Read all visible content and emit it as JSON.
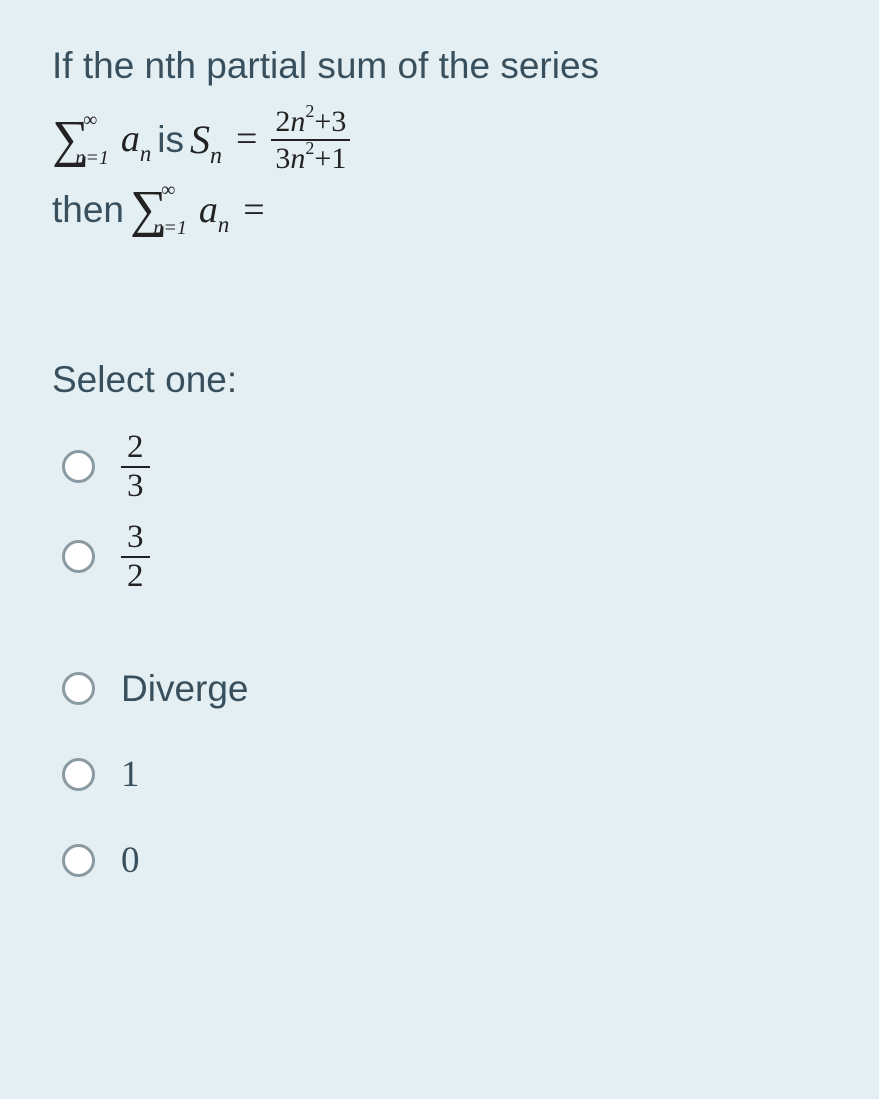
{
  "question": {
    "intro": "If the nth partial sum of the series",
    "sigma_upper": "∞",
    "sigma_lower": "n=1",
    "term": "a",
    "term_sub": "n",
    "is_word": "is",
    "Sn_S": "S",
    "Sn_sub": "n",
    "equals": "=",
    "frac_num_coeff": "2",
    "frac_num_var": "n",
    "frac_num_exp": "2",
    "frac_num_plus": "+3",
    "frac_den_coeff": "3",
    "frac_den_var": "n",
    "frac_den_exp": "2",
    "frac_den_plus": "+1",
    "then_word": "then",
    "sigma2_upper": "∞",
    "sigma2_lower": "n=1",
    "term2": "a",
    "term2_sub": "n",
    "equals2": "="
  },
  "prompt": "Select one:",
  "options": {
    "a_num": "2",
    "a_den": "3",
    "b_num": "3",
    "b_den": "2",
    "c": "Diverge",
    "d": "1",
    "e": "0"
  }
}
